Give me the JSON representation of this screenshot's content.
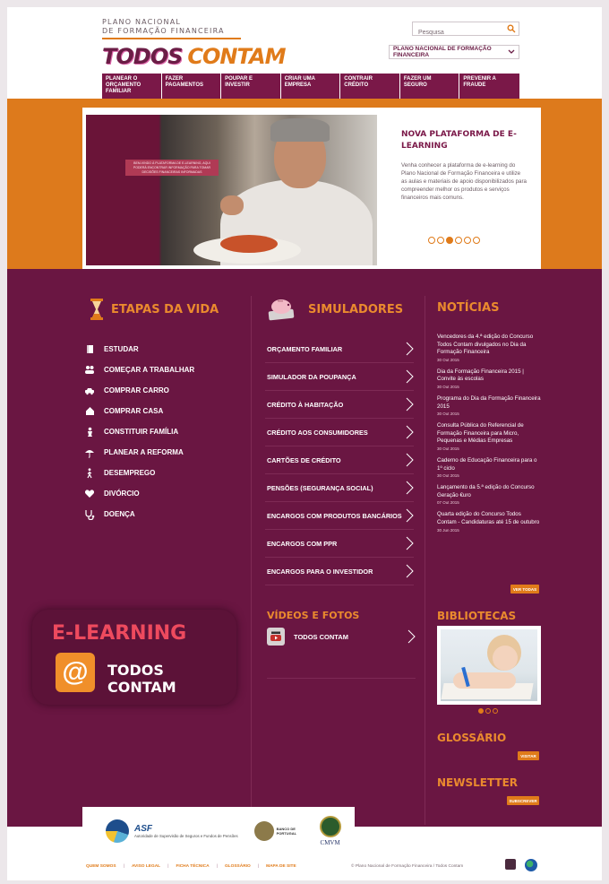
{
  "header": {
    "brand_line1": "PLANO NACIONAL",
    "brand_line2": "DE FORMAÇÃO FINANCEIRA",
    "logo_word1": "TODOS",
    "logo_word2": "CONTAM",
    "search_placeholder": "Pesquisa",
    "dropdown_label": "PLANO NACIONAL DE FORMAÇÃO FINANCEIRA"
  },
  "nav": [
    {
      "label": "PLANEAR O ORÇAMENTO FAMILIAR"
    },
    {
      "label": "FAZER PAGAMENTOS"
    },
    {
      "label": "POUPAR E INVESTIR"
    },
    {
      "label": "CRIAR UMA EMPRESA"
    },
    {
      "label": "CONTRAIR CRÉDITO"
    },
    {
      "label": "FAZER UM SEGURO"
    },
    {
      "label": "PREVENIR A FRAUDE"
    }
  ],
  "hero": {
    "callout": "Bem-vindo à plataforma de e-learning, aqui poderá encontrar informação para tomar decisões financeiras informadas",
    "title": "NOVA PLATAFORMA DE E-LEARNING",
    "description": "Venha conhecer a plataforma de e-learning do Plano Nacional de Formação Financeira e utilize as aulas e materiais de apoio disponibilizados para compreender melhor os produtos e serviços financeiros mais comuns.",
    "slides_total": 6,
    "slide_active": 3
  },
  "etapas": {
    "title": "ETAPAS DA VIDA",
    "items": [
      {
        "label": "ESTUDAR",
        "icon": "book-icon"
      },
      {
        "label": "COMEÇAR A TRABALHAR",
        "icon": "people-icon"
      },
      {
        "label": "COMPRAR CARRO",
        "icon": "car-icon"
      },
      {
        "label": "COMPRAR CASA",
        "icon": "house-icon"
      },
      {
        "label": "CONSTITUIR FAMÍLIA",
        "icon": "family-icon"
      },
      {
        "label": "PLANEAR A REFORMA",
        "icon": "umbrella-icon"
      },
      {
        "label": "DESEMPREGO",
        "icon": "walking-icon"
      },
      {
        "label": "DIVÓRCIO",
        "icon": "heart-icon"
      },
      {
        "label": "DOENÇA",
        "icon": "stethoscope-icon"
      }
    ]
  },
  "simuladores": {
    "title": "SIMULADORES",
    "items": [
      {
        "label": "ORÇAMENTO FAMILIAR"
      },
      {
        "label": "SIMULADOR DA POUPANÇA"
      },
      {
        "label": "CRÉDITO À HABITAÇÃO"
      },
      {
        "label": "CRÉDITO AOS CONSUMIDORES"
      },
      {
        "label": "CARTÕES DE CRÉDITO"
      },
      {
        "label": "PENSÕES (SEGURANÇA SOCIAL)"
      },
      {
        "label": "ENCARGOS COM PRODUTOS BANCÁRIOS"
      },
      {
        "label": "ENCARGOS COM PPR"
      },
      {
        "label": "ENCARGOS PARA O INVESTIDOR"
      }
    ]
  },
  "videos": {
    "title": "VÍDEOS E FOTOS",
    "item_label": "TODOS CONTAM"
  },
  "elearning": {
    "title": "E-LEARNING",
    "subtitle": "TODOS CONTAM",
    "badge": "@"
  },
  "noticias": {
    "title": "NOTÍCIAS",
    "items": [
      {
        "title": "Vencedores da 4.ª edição do Concurso Todos Contam divulgados no Dia da Formação Financeira",
        "date": "30 Out 2015"
      },
      {
        "title": "Dia da Formação Financeira 2015 | Convite às escolas",
        "date": "30 Out 2015"
      },
      {
        "title": "Programa do Dia da Formação Financeira 2015",
        "date": "30 Out 2015"
      },
      {
        "title": "Consulta Pública do Referencial de Formação Financeira para Micro, Pequenas e Médias Empresas",
        "date": "30 Out 2015"
      },
      {
        "title": "Caderno de Educação Financeira para o 1º ciclo",
        "date": "30 Out 2015"
      },
      {
        "title": "Lançamento da 5.ª edição do Concurso Geração €uro",
        "date": "07 Out 2015"
      },
      {
        "title": "Quarta edição do Concurso Todos Contam - Candidaturas até 15 de outubro",
        "date": "30 Jun 2015"
      }
    ],
    "more_label": "VER TODAS"
  },
  "bibliotecas": {
    "title": "BIBLIOTECAS",
    "slides_total": 3,
    "slide_active": 1
  },
  "glossario": {
    "title": "GLOSSÁRIO",
    "button": "VISITAR"
  },
  "newsletter": {
    "title": "NEWSLETTER",
    "button": "SUBSCREVER"
  },
  "partners": {
    "asf_name": "ASF",
    "asf_sub": "Autoridade de Supervisão de Seguros e Fundos de Pensões",
    "bp_name": "BANCO DE PORTUGAL",
    "cmvm_name": "CMVM"
  },
  "footer": {
    "links": [
      "QUEM SOMOS",
      "AVISO LEGAL",
      "FICHA TÉCNICA",
      "GLOSSÁRIO",
      "MAPA DE SITE"
    ],
    "copyright": "© Plano Nacional de Formação Financeira / Todos Contam"
  },
  "colors": {
    "brand_purple": "#6a1642",
    "nav_purple": "#7a1848",
    "accent_orange": "#e07b1a",
    "heading_orange": "#ea8a2e"
  }
}
